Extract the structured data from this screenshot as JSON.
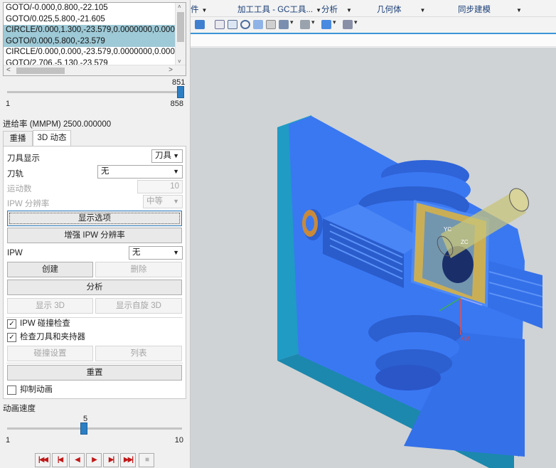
{
  "toolpath_list": {
    "lines": [
      {
        "text": "GOTO/-0.000,0.800,-22.105",
        "selected": false
      },
      {
        "text": "GOTO/0.025,5.800,-21.605",
        "selected": false
      },
      {
        "text": "CIRCLE/0.000,1.300,-23.579,0.0000000,0.0000",
        "selected": true
      },
      {
        "text": "GOTO/0.000,5.800,-23.579",
        "selected": true
      },
      {
        "text": "CIRCLE/0.000,0.000,-23.579,0.0000000,0.0000",
        "selected": false
      },
      {
        "text": "GOTO/2.706,-5.130,-23.579",
        "selected": false
      }
    ],
    "scroll_up": "˄",
    "scroll_down": "˅",
    "scroll_left": "<",
    "scroll_right": ">"
  },
  "position_slider": {
    "value": "851",
    "min": "1",
    "max": "858",
    "fraction": 0.99
  },
  "feed_rate_label": "进给率 (MMPM) 2500.000000",
  "tabs": [
    {
      "label": "重播",
      "active": false
    },
    {
      "label": "3D 动态",
      "active": true
    }
  ],
  "form": {
    "tool_display_label": "刀具显示",
    "tool_display_value": "刀具",
    "toolpath_label": "刀轨",
    "toolpath_value": "无",
    "motion_count_label": "运动数",
    "motion_count_value": "10",
    "ipw_resolution_label": "IPW 分辨率",
    "ipw_resolution_value": "中等",
    "display_options_button": "显示选项",
    "enhance_ipw_button": "增强 IPW 分辨率",
    "ipw_label": "IPW",
    "ipw_value": "无",
    "create_button": "创建",
    "delete_button": "删除",
    "analyze_button": "分析",
    "show_3d_button": "显示 3D",
    "show_rotate_3d_button": "显示自旋 3D",
    "ipw_collision_check": {
      "label": "IPW 碰撞检查",
      "checked": true
    },
    "check_tool_holder": {
      "label": "检查刀具和夹持器",
      "checked": true
    },
    "collision_settings_button": "碰撞设置",
    "list_button": "列表",
    "reset_button": "重置",
    "suppress_animation": {
      "label": "抑制动画",
      "checked": false
    }
  },
  "animation_speed": {
    "label": "动画速度",
    "value": "5",
    "min": "1",
    "max": "10",
    "fraction": 0.44
  },
  "playback": {
    "to_start": "|◀◀",
    "step_back": "|◀",
    "play_reverse": "◀",
    "play_forward": "▶",
    "step_forward": "▶|",
    "to_end": "▶▶|",
    "stop": "■"
  },
  "menubar": {
    "items": [
      "件",
      "加工工具 - GC工具...",
      "分析",
      "几何体",
      "同步建模"
    ]
  },
  "viewport": {
    "axis_labels": {
      "yc": "YC",
      "zc": "ZC",
      "xm": "XM"
    },
    "colors": {
      "part": "#3a78f2",
      "part_dark": "#2a56c8",
      "side": "#1f9bc4",
      "cut_highlight": "#f2b32a",
      "tool": "#c8c47a"
    }
  }
}
